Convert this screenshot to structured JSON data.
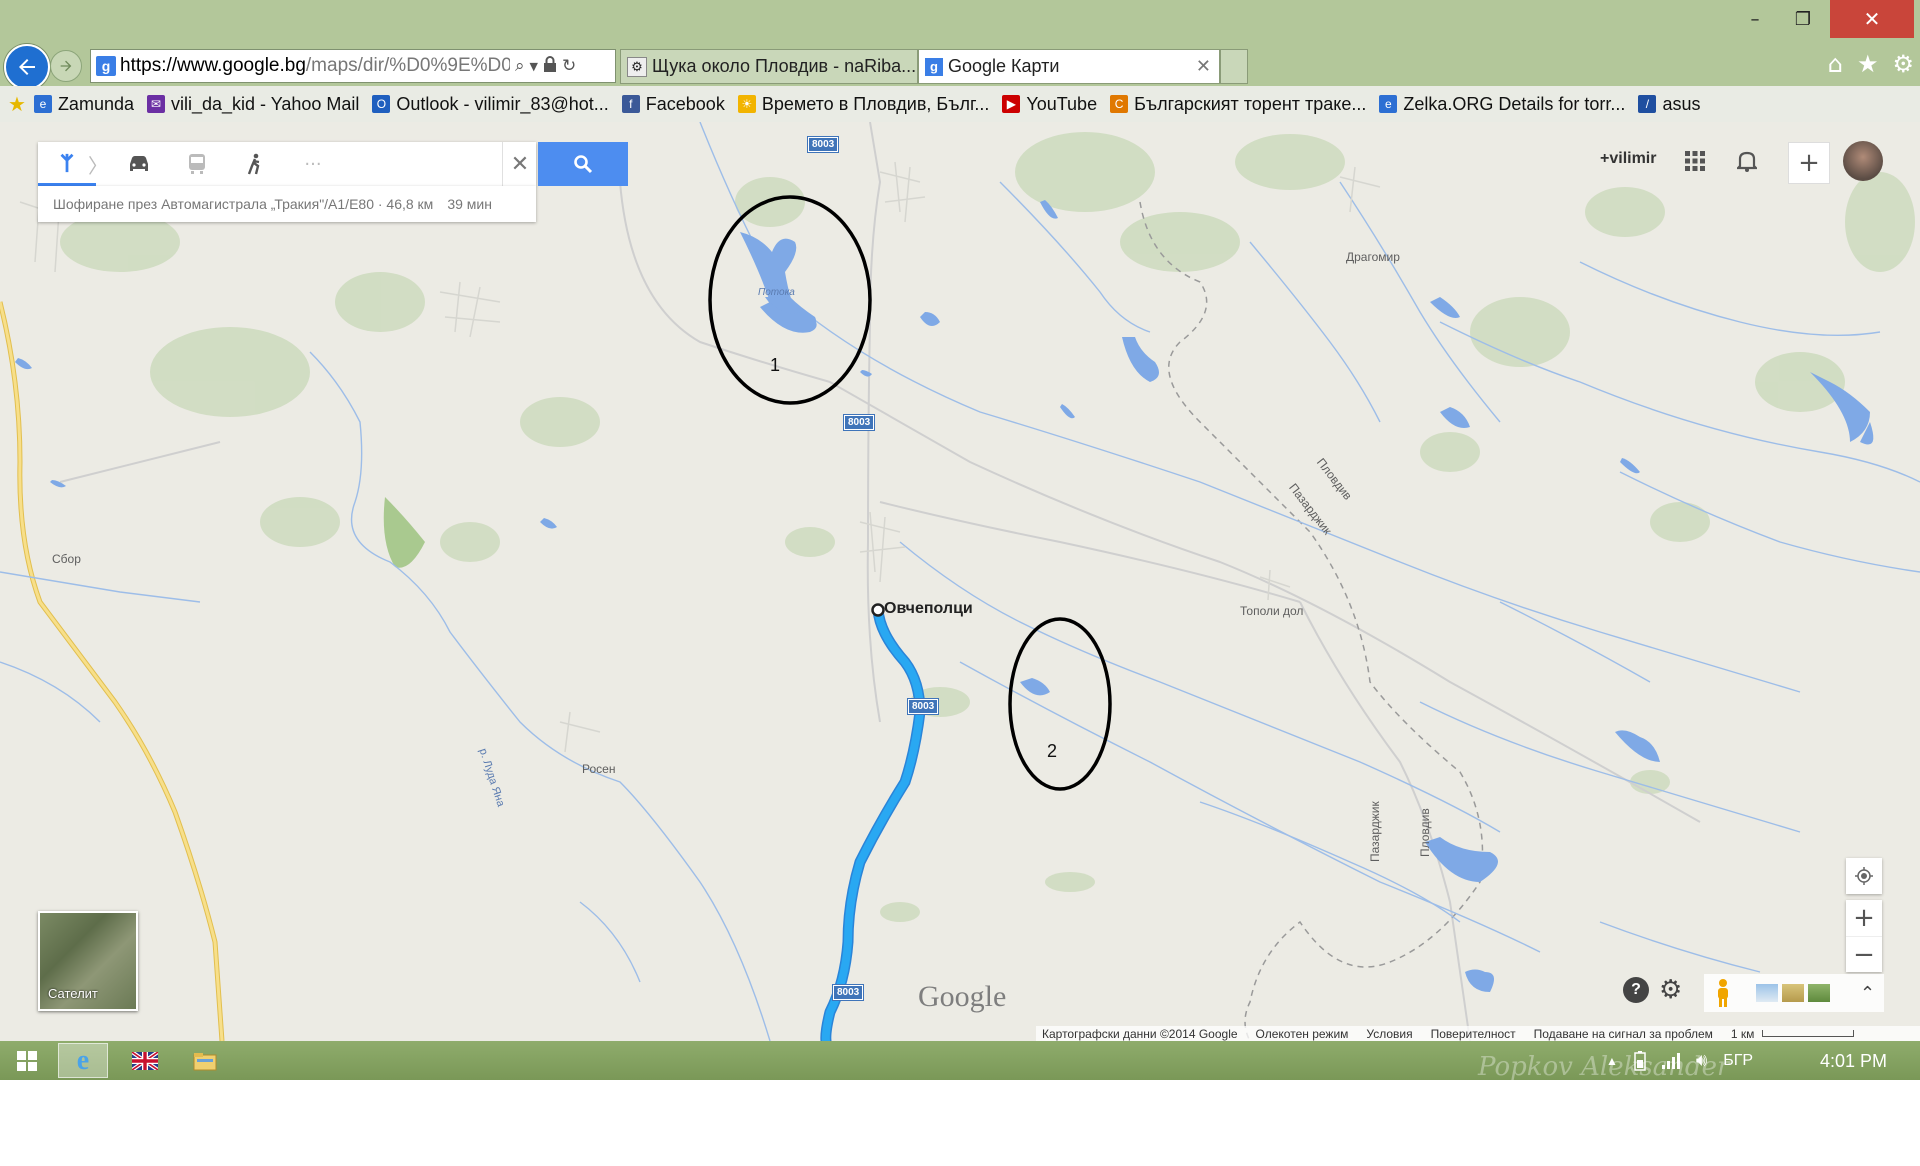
{
  "window": {
    "controls": {
      "minimize": "–",
      "maximize": "❐",
      "close": "✕"
    }
  },
  "browser": {
    "address": {
      "domain": "https://www.google.bg",
      "path": "/maps/dir/%D0%9E%D09"
    },
    "tabs": [
      {
        "title": "Щука около Пловдив - naRiba..."
      },
      {
        "title": "Google Карти"
      }
    ]
  },
  "favorites": [
    {
      "label": "Zamunda",
      "icon": "ie-page-icon",
      "color": "#2d6fd3"
    },
    {
      "label": "vili_da_kid - Yahoo Mail",
      "icon": "mail-icon",
      "color": "#6b2fa3"
    },
    {
      "label": "Outlook - vilimir_83@hot...",
      "icon": "outlook-icon",
      "color": "#1f5fbf"
    },
    {
      "label": "Facebook",
      "icon": "facebook-icon",
      "color": "#3b5998"
    },
    {
      "label": "Времето в Пловдив, Бълг...",
      "icon": "weather-icon",
      "color": "#f2b400"
    },
    {
      "label": "YouTube",
      "icon": "youtube-icon",
      "color": "#cc0000"
    },
    {
      "label": "Българският торент траке...",
      "icon": "torrent-icon",
      "color": "#e07800"
    },
    {
      "label": "Zelka.ORG  Details for torr...",
      "icon": "ie-page-icon",
      "color": "#2d6fd3"
    },
    {
      "label": "asus",
      "icon": "asus-icon",
      "color": "#1f4fa0"
    }
  ],
  "directions": {
    "modes": [
      "directions-icon",
      "car-icon",
      "transit-icon",
      "walk-icon",
      "more-icon"
    ],
    "more_label": "···",
    "route_summary": "Шофиране през Автомагистрала „Тракия\"/A1/E80 · 46,8 км",
    "duration": "39 мин"
  },
  "account": {
    "name": "+vilimir"
  },
  "map": {
    "places": {
      "ovchepoltsi": "Овчеполци",
      "dragomir": "Драгомир",
      "topoli_dol": "Тополи дол",
      "sbor": "Сбор",
      "rosen": "Росен",
      "potoka": "Потока"
    },
    "road_labels": {
      "plovdiv": "Пловдив",
      "pazardzhik": "Пазарджик",
      "river": "р. Луда Яна"
    },
    "road_number": "8003",
    "annotations": {
      "first": "1",
      "second": "2"
    },
    "satellite_label": "Сателит",
    "google_logo": "Google",
    "footer": {
      "copyright": "Картографски данни ©2014 Google",
      "lite_mode": "Олекотен режим",
      "terms": "Условия",
      "privacy": "Поверителност",
      "report": "Подаване на сигнал за проблем",
      "scale": "1 км"
    },
    "help_label": "?",
    "zoom_in": "+",
    "zoom_out": "−",
    "colors": {
      "route": "#2196f3",
      "water": "#7fa9e6",
      "land": "#ecebe4",
      "highway": "#f5d36b"
    }
  },
  "taskbar": {
    "lang": "БГР",
    "time": "4:01 PM",
    "watermark": "Popkov Aleksander"
  }
}
